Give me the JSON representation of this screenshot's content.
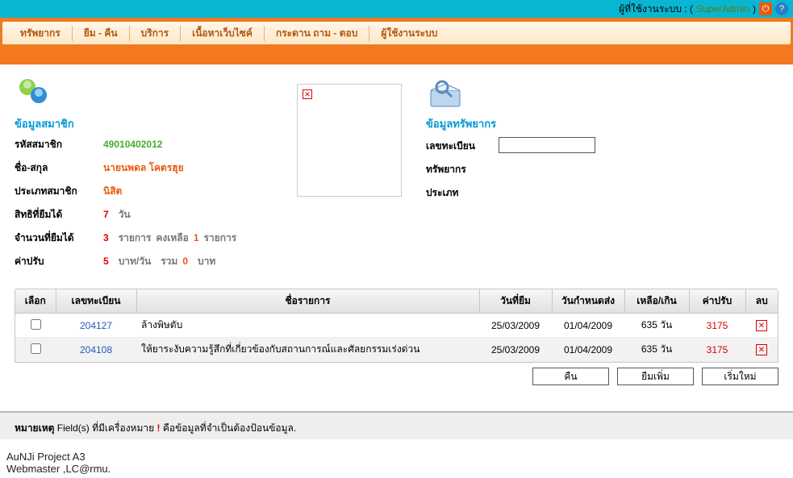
{
  "topbar": {
    "label": "ผู้ที่ใช้งานระบบ : (",
    "user": "SuperAdmin",
    "close_paren": ")"
  },
  "menu": {
    "items": [
      "ทรัพยากร",
      "ยืม - คืน",
      "บริการ",
      "เนื้อหาเว็บไซค์",
      "กระดาน ถาม - ตอบ",
      "ผู้ใช้งานระบบ"
    ]
  },
  "member": {
    "title": "ข้อมูลสมาชิก",
    "labels": {
      "id": "รหัสสมาชิก",
      "name": "ชื่อ-สกุล",
      "type": "ประเภทสมาชิก",
      "rights": "สิทธิที่ยืมได้",
      "count": "จำนวนที่ยืมได้",
      "fine": "ค่าปรับ"
    },
    "id": "49010402012",
    "name": "นายนพดล   โคตรฮุย",
    "type": "นิสิต",
    "rights_num": "7",
    "rights_unit": "วัน",
    "count_num": "3",
    "count_unit1": "รายการ",
    "count_remain_label": "คงเหลือ",
    "count_remain_num": "1",
    "count_unit2": "รายการ",
    "fine_num": "5",
    "fine_unit": "บาท/วัน",
    "fine_total_label": "รวม",
    "fine_total_num": "0",
    "fine_total_unit": "บาท"
  },
  "resource": {
    "title": "ข้อมูลทรัพยากร",
    "labels": {
      "reg": "เลขทะเบียน",
      "res": "ทรัพยากร",
      "type": "ประเภท"
    },
    "reg_value": ""
  },
  "table": {
    "headers": [
      "เลือก",
      "เลขทะเบียน",
      "ชื่อรายการ",
      "วันที่ยืม",
      "วันกำหนดส่ง",
      "เหลือ/เกิน",
      "ค่าปรับ",
      "ลบ"
    ],
    "rows": [
      {
        "reg": "204127",
        "title": "ล้างพิษตับ",
        "borrow": "25/03/2009",
        "due": "01/04/2009",
        "over": "635 วัน",
        "fine": "3175"
      },
      {
        "reg": "204108",
        "title": "ให้ยาระงับความรู้สึกที่เกี่ยวข้องกับสถานการณ์และศัลยกรรมเร่งด่วน",
        "borrow": "25/03/2009",
        "due": "01/04/2009",
        "over": "635 วัน",
        "fine": "3175"
      }
    ]
  },
  "buttons": {
    "return": "คืน",
    "borrow_more": "ยืมเพิ่ม",
    "restart": "เริ่มใหม่"
  },
  "note": {
    "label": "หมายเหตุ",
    "text1": "Field(s) ที่มีเครื่องหมาย",
    "mark": "!",
    "text2": "คือข้อมูลที่จำเป็นต้องป้อนข้อมูล."
  },
  "footer": {
    "line1": "AuNJi Project A3",
    "line2": "Webmaster ,LC@rmu."
  }
}
